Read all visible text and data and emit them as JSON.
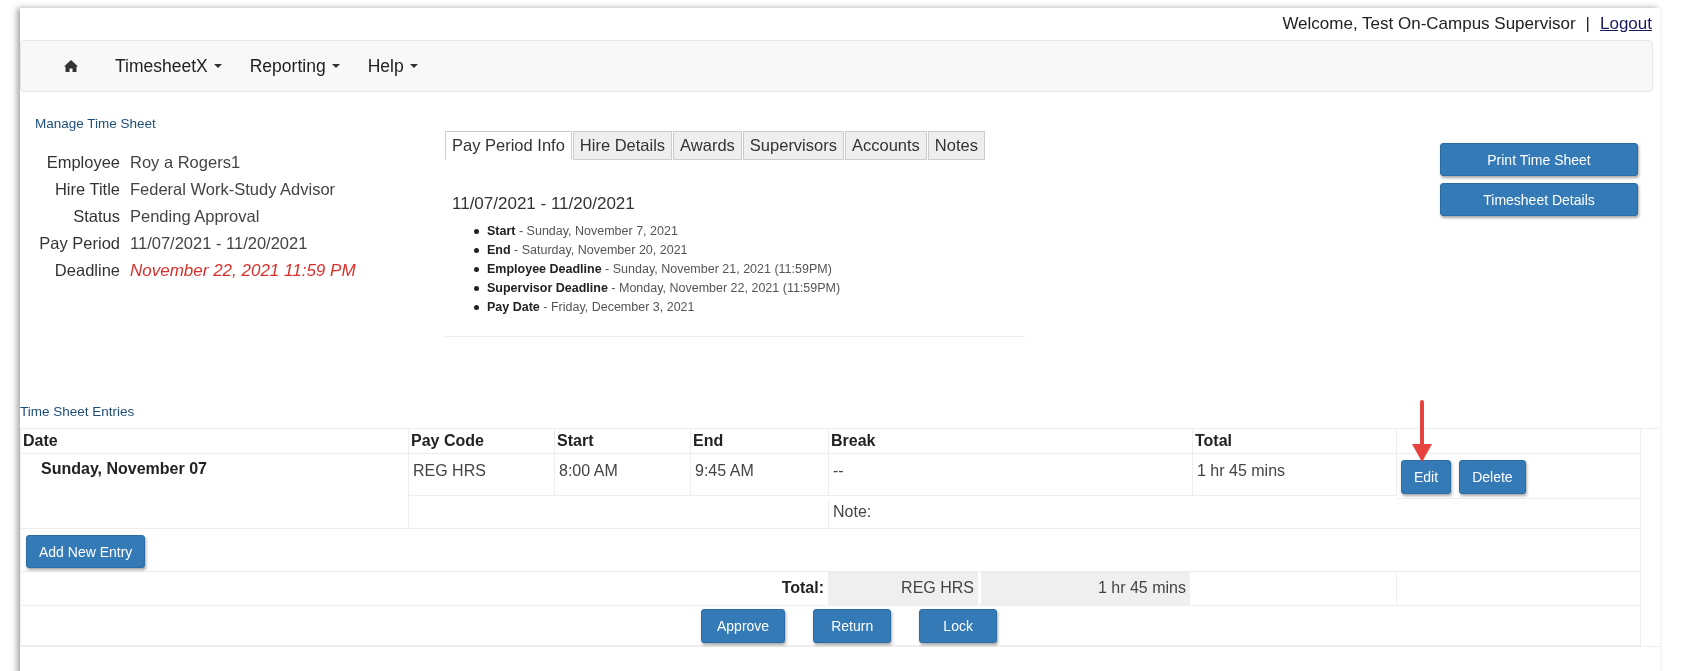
{
  "header": {
    "welcome": "Welcome, Test On-Campus Supervisor",
    "separator": "|",
    "logout": "Logout"
  },
  "nav": {
    "items": [
      {
        "label": "TimesheetX",
        "dropdown": true
      },
      {
        "label": "Reporting",
        "dropdown": true
      },
      {
        "label": "Help",
        "dropdown": true
      }
    ]
  },
  "manage": {
    "title": "Manage Time Sheet",
    "fields": [
      {
        "label": "Employee",
        "value": "Roy a Rogers1",
        "alert": false
      },
      {
        "label": "Hire Title",
        "value": "Federal Work-Study Advisor",
        "alert": false
      },
      {
        "label": "Status",
        "value": "Pending Approval",
        "alert": false
      },
      {
        "label": "Pay Period",
        "value": "11/07/2021 - 11/20/2021",
        "alert": false
      },
      {
        "label": "Deadline",
        "value": "November 22, 2021 11:59 PM",
        "alert": true
      }
    ]
  },
  "tabs": [
    {
      "label": "Pay Period Info",
      "selected": true
    },
    {
      "label": "Hire Details",
      "selected": false
    },
    {
      "label": "Awards",
      "selected": false
    },
    {
      "label": "Supervisors",
      "selected": false
    },
    {
      "label": "Accounts",
      "selected": false
    },
    {
      "label": "Notes",
      "selected": false
    }
  ],
  "pay_period": {
    "heading": "11/07/2021 - 11/20/2021",
    "items": [
      "**Start** - Sunday, November 7, 2021",
      "**End** - Saturday, November 20, 2021",
      "**Employee Deadline** - Sunday, November 21, 2021 (11:59PM)",
      "**Supervisor Deadline** - Monday, November 22, 2021 (11:59PM)",
      "**Pay Date** - Friday, December 3, 2021"
    ]
  },
  "actions": [
    "Print Time Sheet",
    "Timesheet Details"
  ],
  "entries": {
    "title": "Time Sheet Entries",
    "columns": [
      "Date",
      "Pay Code",
      "Start",
      "End",
      "Break",
      "Total"
    ],
    "rows": [
      {
        "date": "Sunday, November 07",
        "pay_code": "REG HRS",
        "start": "8:00 AM",
        "end": "9:45 AM",
        "break": "--",
        "total": "1 hr 45 mins",
        "note_label": "Note:",
        "buttons": [
          "Edit",
          "Delete"
        ]
      }
    ],
    "add_button": "Add New Entry",
    "summary": {
      "label": "Total:",
      "pay_code": "REG HRS",
      "total": "1 hr 45 mins"
    },
    "buttons": [
      "Approve",
      "Return",
      "Lock"
    ]
  }
}
